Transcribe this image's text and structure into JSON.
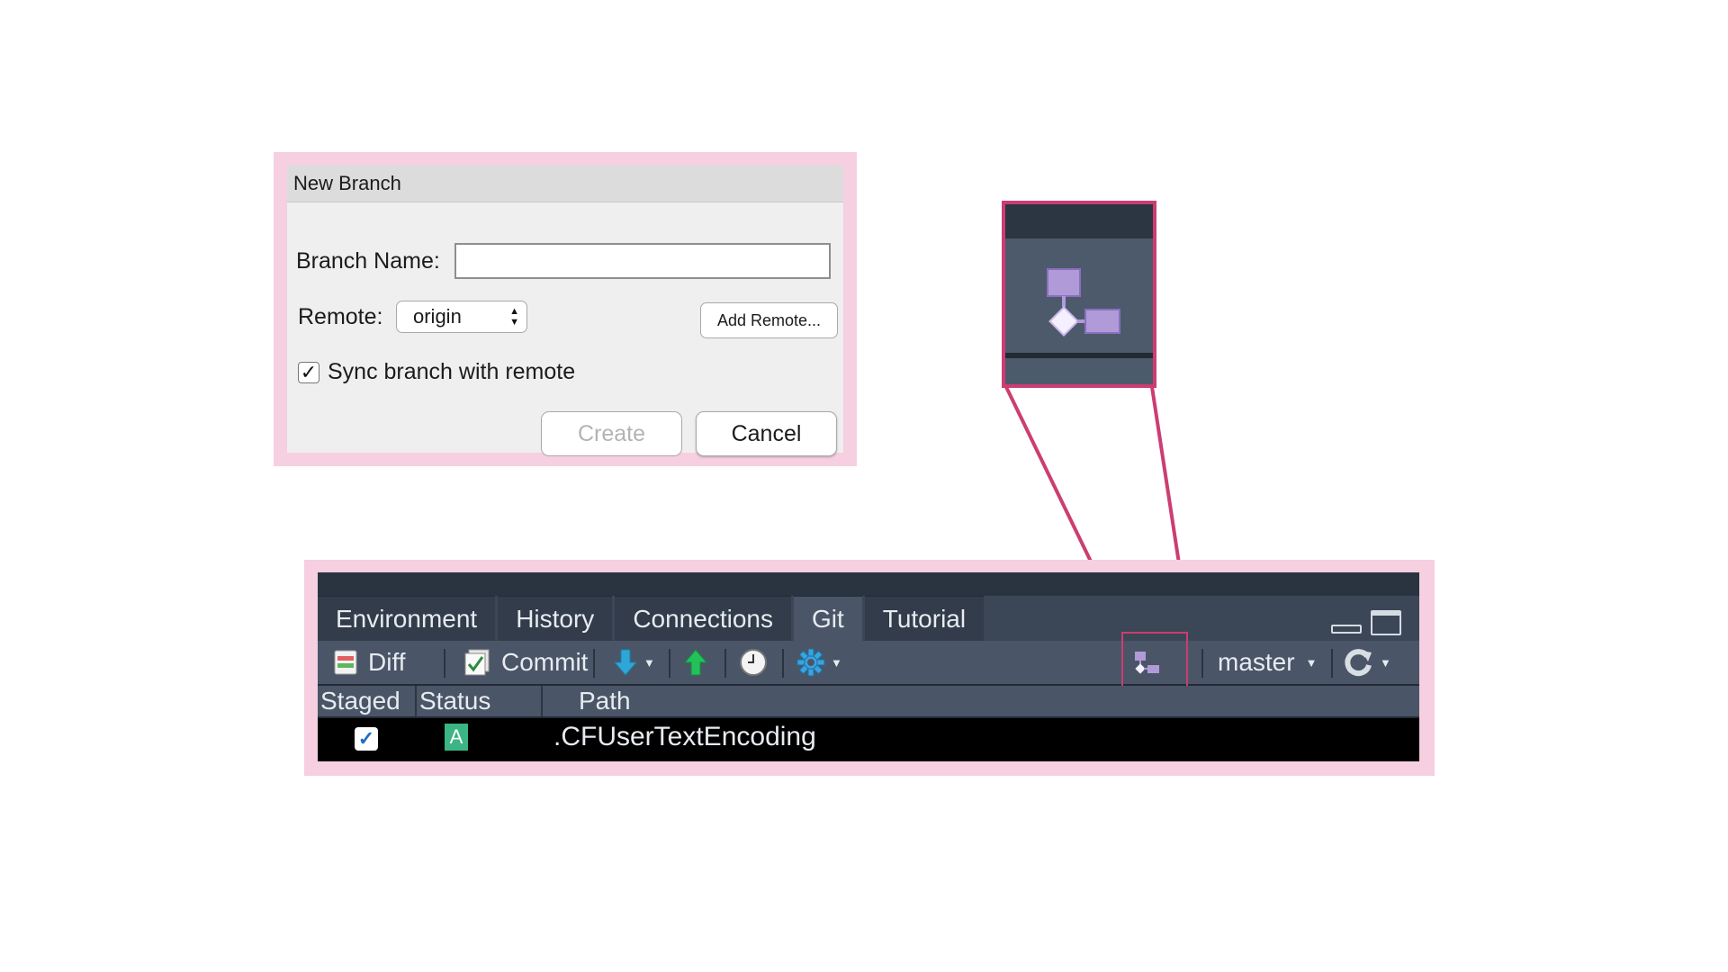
{
  "dialog": {
    "title": "New Branch",
    "branch_name_label": "Branch Name:",
    "branch_name_value": "",
    "remote_label": "Remote:",
    "remote_value": "origin",
    "add_remote_label": "Add Remote...",
    "sync_label": "Sync branch with remote",
    "sync_checked": true,
    "create_label": "Create",
    "cancel_label": "Cancel"
  },
  "pane": {
    "tabs": [
      {
        "label": "Environment",
        "active": false
      },
      {
        "label": "History",
        "active": false
      },
      {
        "label": "Connections",
        "active": false
      },
      {
        "label": "Git",
        "active": true
      },
      {
        "label": "Tutorial",
        "active": false
      }
    ],
    "toolbar": {
      "diff_label": "Diff",
      "commit_label": "Commit",
      "branch_label": "master"
    },
    "columns": [
      "Staged",
      "Status",
      "Path"
    ],
    "rows": [
      {
        "staged": true,
        "status": "A",
        "path": ".CFUserTextEncoding"
      }
    ]
  },
  "colors": {
    "highlight": "#cc3d72",
    "frame": "#f6cfe0",
    "pane_bg": "#3b4757",
    "branch_icon": "#b09ad8"
  },
  "icons": [
    "diff-icon",
    "commit-icon",
    "pull-arrow-icon",
    "push-arrow-icon",
    "history-clock-icon",
    "gear-icon",
    "new-branch-icon",
    "refresh-icon"
  ]
}
